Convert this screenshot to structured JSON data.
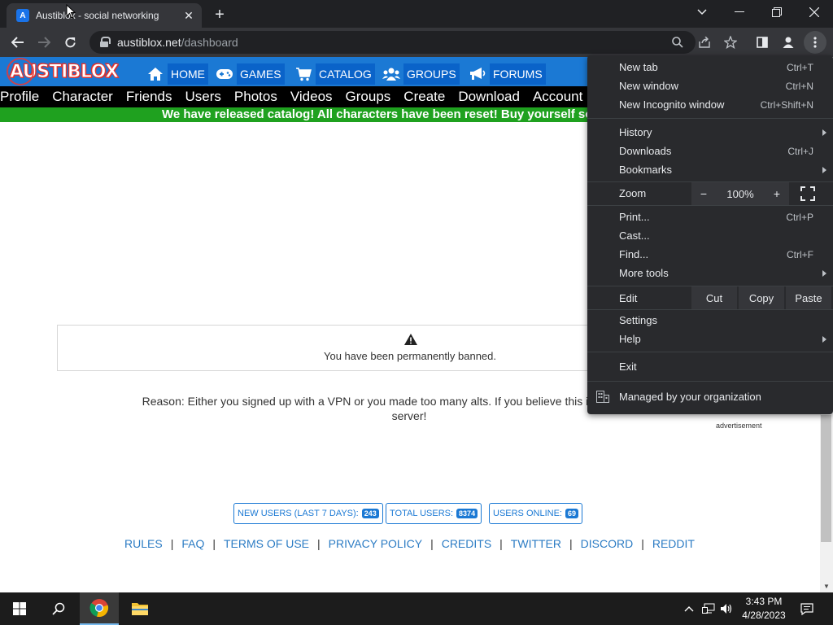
{
  "browser": {
    "tab_title": "Austiblox - social networking",
    "tab_favicon_letter": "A",
    "url_host": "austiblox.net",
    "url_path": "/dashboard"
  },
  "site": {
    "logo_text": "AUSTIBLOX",
    "top_nav": [
      {
        "label": "HOME",
        "icon": "home-icon"
      },
      {
        "label": "GAMES",
        "icon": "gamepad-icon"
      },
      {
        "label": "CATALOG",
        "icon": "cart-icon"
      },
      {
        "label": "GROUPS",
        "icon": "users-icon"
      },
      {
        "label": "FORUMS",
        "icon": "megaphone-icon"
      }
    ],
    "sub_nav": [
      "Profile",
      "Character",
      "Friends",
      "Users",
      "Photos",
      "Videos",
      "Groups",
      "Create",
      "Download",
      "Account"
    ],
    "banner": "We have released catalog! All characters have been reset! Buy yourself som"
  },
  "ban": {
    "message": "You have been permanently banned.",
    "reason_label": "Reason",
    "reason_line1": ": Either you signed up with a VPN or you made too many alts. If you believe this is an error, please",
    "reason_line2": "server!"
  },
  "advertisement_label": "advertisement",
  "stats": [
    {
      "label": "NEW USERS (LAST 7 DAYS):",
      "value": "243"
    },
    {
      "label": "TOTAL USERS:",
      "value": "8374"
    },
    {
      "label": "USERS ONLINE:",
      "value": "69"
    }
  ],
  "footer_links": [
    "RULES",
    "FAQ",
    "TERMS OF USE",
    "PRIVACY POLICY",
    "CREDITS",
    "TWITTER",
    "DISCORD",
    "REDDIT"
  ],
  "menu": {
    "new_tab": {
      "label": "New tab",
      "shortcut": "Ctrl+T"
    },
    "new_window": {
      "label": "New window",
      "shortcut": "Ctrl+N"
    },
    "new_incognito": {
      "label": "New Incognito window",
      "shortcut": "Ctrl+Shift+N"
    },
    "history": {
      "label": "History"
    },
    "downloads": {
      "label": "Downloads",
      "shortcut": "Ctrl+J"
    },
    "bookmarks": {
      "label": "Bookmarks"
    },
    "zoom": {
      "label": "Zoom",
      "minus": "−",
      "value": "100%",
      "plus": "+"
    },
    "print": {
      "label": "Print...",
      "shortcut": "Ctrl+P"
    },
    "cast": {
      "label": "Cast..."
    },
    "find": {
      "label": "Find...",
      "shortcut": "Ctrl+F"
    },
    "more_tools": {
      "label": "More tools"
    },
    "edit": {
      "label": "Edit",
      "cut": "Cut",
      "copy": "Copy",
      "paste": "Paste"
    },
    "settings": {
      "label": "Settings"
    },
    "help": {
      "label": "Help"
    },
    "exit": {
      "label": "Exit"
    },
    "managed": {
      "label": "Managed by your organization"
    }
  },
  "taskbar": {
    "time": "3:43 PM",
    "date": "4/28/2023"
  }
}
